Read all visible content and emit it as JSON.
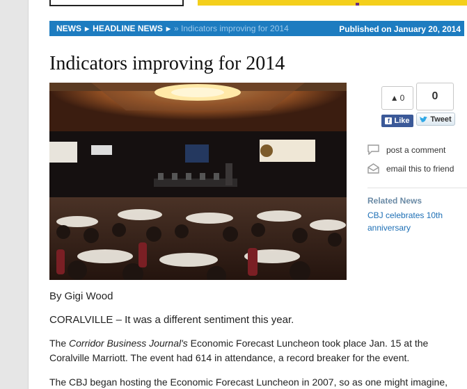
{
  "breadcrumb": {
    "items": [
      "NEWS",
      "HEADLINE NEWS"
    ],
    "current": "Indicators improving for 2014",
    "published": "Published on January 20, 2014"
  },
  "article": {
    "title": "Indicators improving for 2014",
    "byline": "By Gigi Wood",
    "lead": "CORALVILLE – It was a different sentiment this year.",
    "p1_pre": "The ",
    "p1_em": "Corridor Business Journal's",
    "p1_post": " Economic Forecast Luncheon took place Jan. 15 at the Coralville Marriott. The event had 614 in attendance, a record breaker for the event.",
    "p2": "The CBJ began hosting the Economic Forecast Luncheon in 2007, so as one might imagine,"
  },
  "photo": {
    "banners": [
      "MAN",
      "AITC",
      "Trust",
      "MCKEAN MANSFIELD"
    ]
  },
  "social": {
    "like_count": "0",
    "like_label": "Like",
    "tweet_count": "0",
    "tweet_label": "Tweet"
  },
  "sidebar": {
    "post_comment": "post a comment",
    "email_friend": "email this to friend",
    "related_title": "Related News",
    "related_link": "CBJ celebrates 10th anniversary"
  },
  "colors": {
    "breadcrumb_bg": "#1d7cc0",
    "top_accent": "#f4cf1b",
    "link": "#1d6fb5",
    "facebook": "#3b5998"
  }
}
